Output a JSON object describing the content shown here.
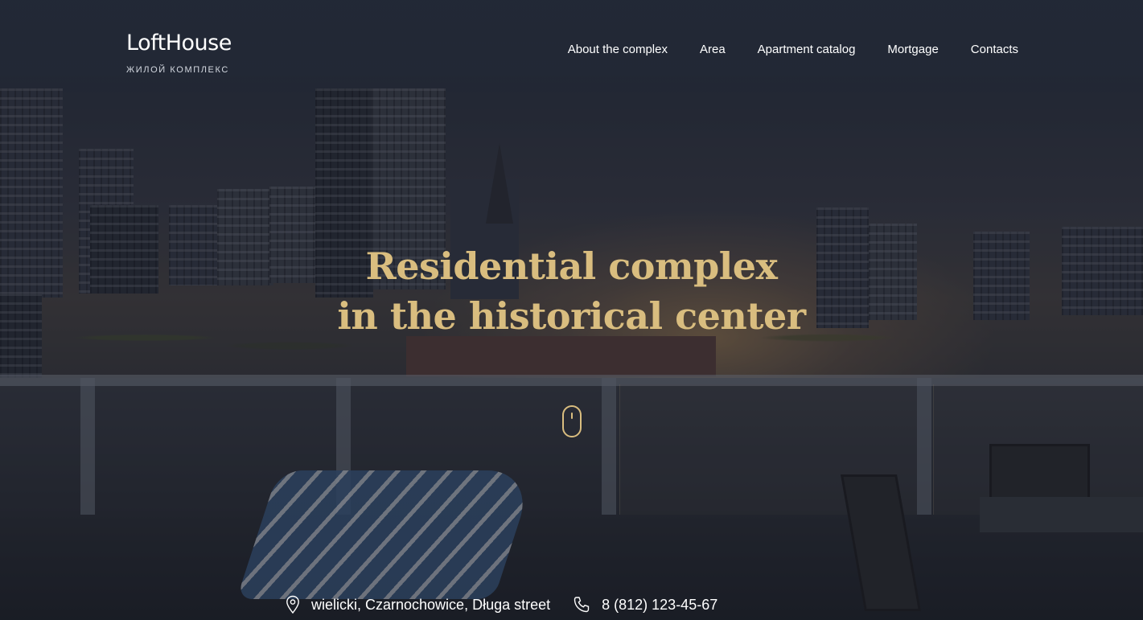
{
  "brand": {
    "name": "LoftHouse",
    "tagline": "ЖИЛОЙ КОМПЛЕКС"
  },
  "nav": {
    "items": [
      {
        "label": "About the complex"
      },
      {
        "label": "Area"
      },
      {
        "label": "Apartment catalog"
      },
      {
        "label": "Mortgage"
      },
      {
        "label": "Contacts"
      }
    ]
  },
  "hero": {
    "title_line1": "Residential complex",
    "title_line2": "in the historical center",
    "scroll_icon": "mouse-scroll-icon"
  },
  "contacts": {
    "address": "wielicki, Czarnochowice, Długa street",
    "address_icon": "location-pin-icon",
    "phone": "8 (812) 123-45-67",
    "phone_icon": "phone-icon"
  },
  "colors": {
    "accent_gold": "#d9bd7f",
    "header_bg": "#222936",
    "text": "#ffffff"
  }
}
